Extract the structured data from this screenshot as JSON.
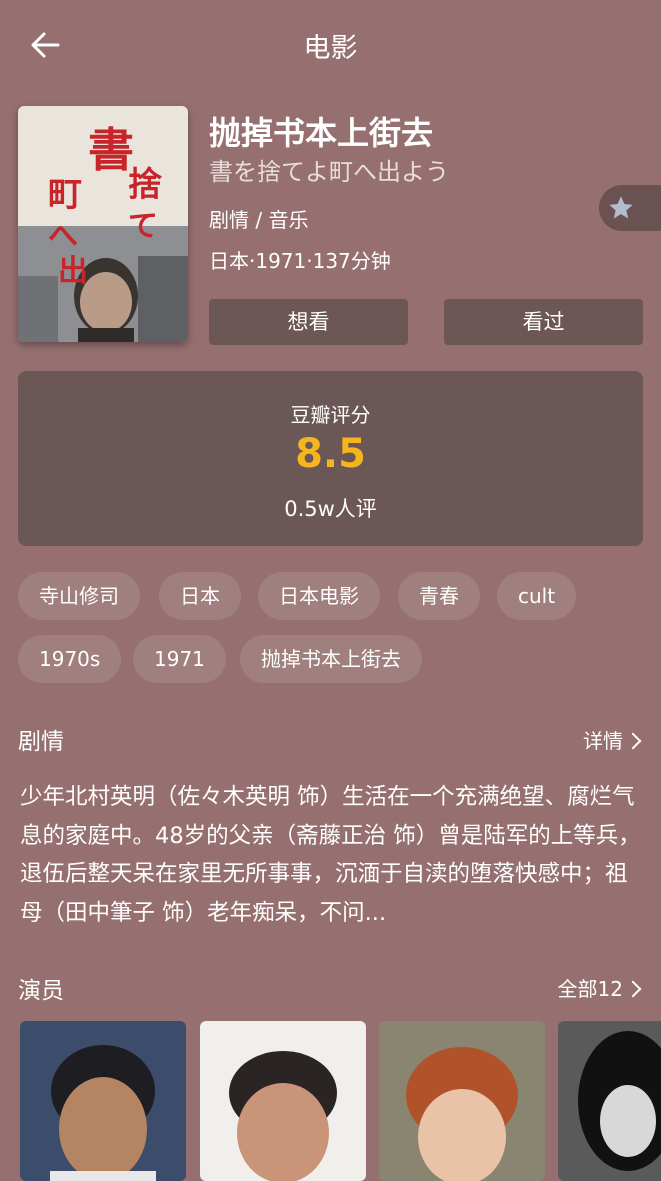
{
  "header": {
    "title": "电影",
    "back_icon": "arrow-left-icon"
  },
  "movie": {
    "title": "抛掉书本上街去",
    "original_title": "書を捨てよ町へ出よう",
    "genres": "剧情 / 音乐",
    "info": "日本·1971·137分钟",
    "poster_text": "書を捨てよ町へ出よう"
  },
  "actions": {
    "want_label": "想看",
    "seen_label": "看过",
    "favorite_icon": "star-icon"
  },
  "rating": {
    "label": "豆瓣评分",
    "score": "8.5",
    "count": "0.5w人评",
    "score_color": "#f5b51e"
  },
  "tags": [
    "寺山修司",
    "日本",
    "日本电影",
    "青春",
    "cult",
    "1970s",
    "1971",
    "抛掉书本上街去"
  ],
  "plot": {
    "heading": "剧情",
    "more_label": "详情",
    "text": "少年北村英明（佐々木英明 饰）生活在一个充满绝望、腐烂气息的家庭中。48岁的父亲（斋藤正治 饰）曾是陆军的上等兵，退伍后整天呆在家里无所事事，沉湎于自渎的堕落快感中；祖母（田中筆子 饰）老年痴呆，不问..."
  },
  "cast": {
    "heading": "演员",
    "more_label": "全部12"
  },
  "colors": {
    "background": "#967070",
    "panel": "#6c5757",
    "tag": "#a07f7f",
    "accent": "#f5b51e"
  }
}
